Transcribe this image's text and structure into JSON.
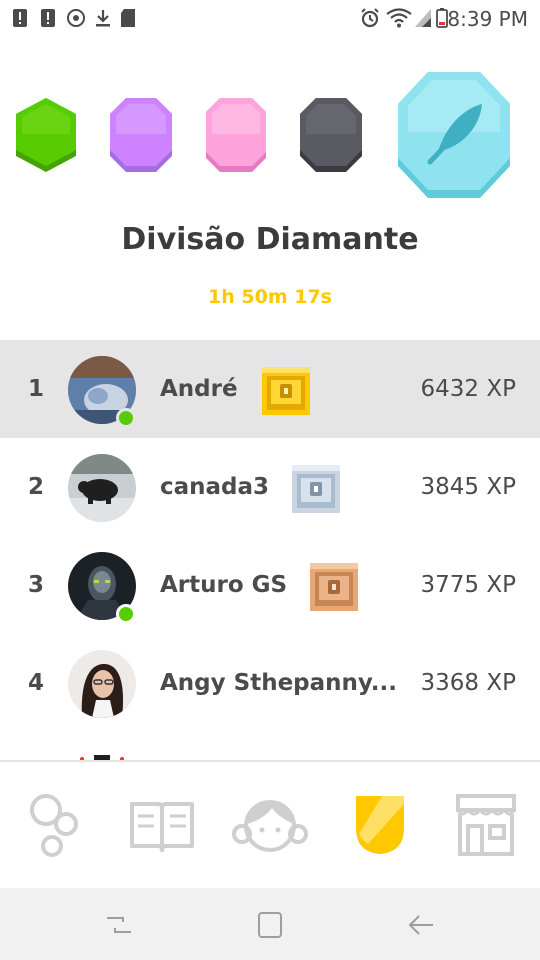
{
  "status_bar": {
    "time": "8:39 PM",
    "icons": [
      "alert-icon",
      "alert-icon",
      "sync-icon",
      "download-icon",
      "sd-card-icon",
      "alarm-icon",
      "wifi-icon",
      "signal-icon",
      "battery-low-icon"
    ]
  },
  "league": {
    "badges": [
      "bronze-league-badge",
      "amethyst-league-badge",
      "pearl-league-badge",
      "obsidian-league-badge",
      "diamond-league-badge"
    ],
    "title": "Divisão Diamante",
    "countdown": "1h 50m 17s"
  },
  "leaderboard": [
    {
      "rank": "1",
      "name": "André",
      "xp": "6432 XP",
      "online": true,
      "chest": "gold-chest-icon",
      "current_user": true
    },
    {
      "rank": "2",
      "name": "canada3",
      "xp": "3845 XP",
      "online": false,
      "chest": "silver-chest-icon",
      "current_user": false
    },
    {
      "rank": "3",
      "name": "Arturo GS",
      "xp": "3775 XP",
      "online": true,
      "chest": "bronze-chest-icon",
      "current_user": false
    },
    {
      "rank": "4",
      "name": "Angy Sthepanny...",
      "xp": "3368 XP",
      "online": false,
      "chest": "",
      "current_user": false
    }
  ],
  "nav": {
    "items": [
      "learn-icon",
      "stories-icon",
      "profile-icon",
      "leaderboard-shield-icon",
      "shop-icon"
    ],
    "active": "leaderboard-shield-icon"
  },
  "colors": {
    "countdown": "#ffc800",
    "online": "#58cc02",
    "highlight_row": "#e5e5e5",
    "diamond": "#8ee3ef",
    "nav_active": "#ffc800",
    "nav_inactive": "#cfcfcf"
  }
}
